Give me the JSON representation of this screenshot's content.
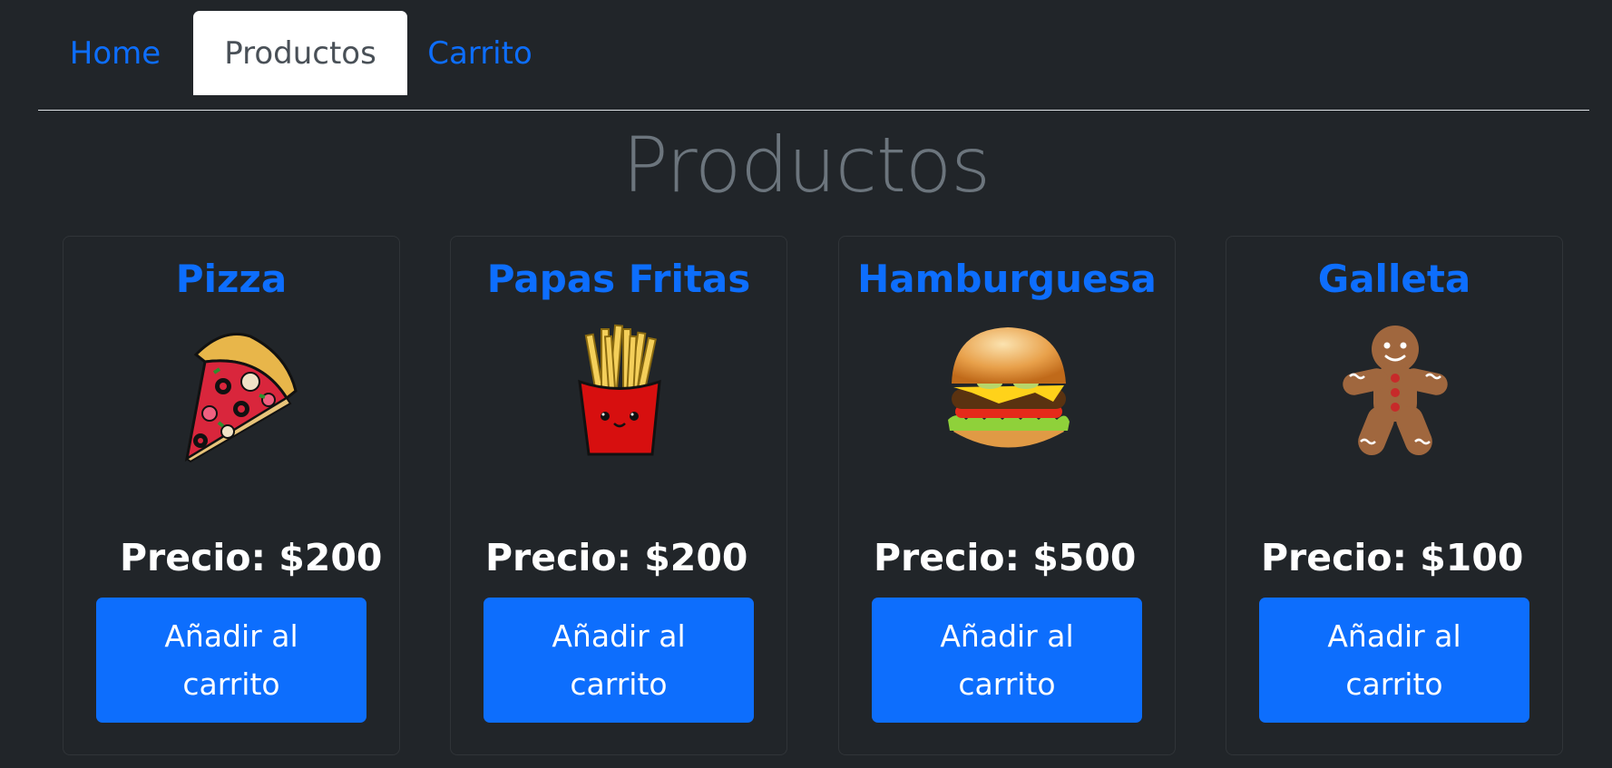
{
  "nav": {
    "tabs": [
      {
        "label": "Home",
        "active": false
      },
      {
        "label": "Productos",
        "active": true
      },
      {
        "label": "Carrito",
        "active": false
      }
    ]
  },
  "page": {
    "title": "Productos"
  },
  "products": [
    {
      "name": "Pizza",
      "price": "Precio: $200",
      "button": "Añadir al carrito",
      "icon": "pizza-icon"
    },
    {
      "name": "Papas Fritas",
      "price": "Precio: $200",
      "button": "Añadir al carrito",
      "icon": "fries-icon"
    },
    {
      "name": "Hamburguesa",
      "price": "Precio: $500",
      "button": "Añadir al carrito",
      "icon": "burger-icon"
    },
    {
      "name": "Galleta",
      "price": "Precio: $100",
      "button": "Añadir al carrito",
      "icon": "gingerbread-icon"
    }
  ],
  "colors": {
    "background": "#212529",
    "accent": "#0d6efd",
    "title": "#6c757d",
    "text": "#ffffff"
  }
}
